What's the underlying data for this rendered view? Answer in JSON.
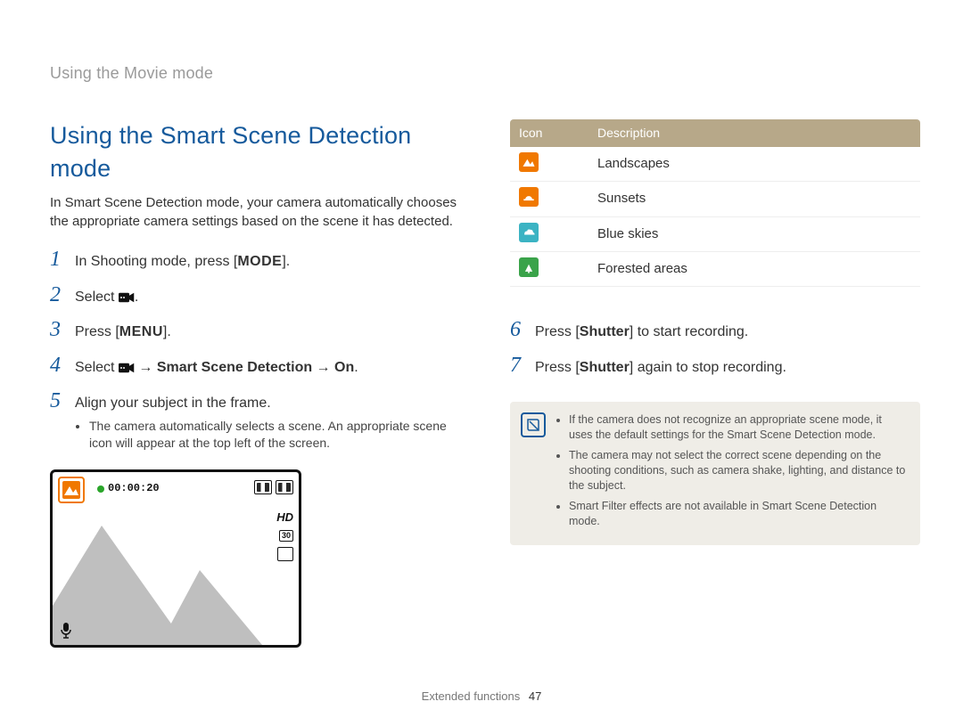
{
  "breadcrumb": "Using the Movie mode",
  "title": "Using the Smart Scene Detection mode",
  "intro": "In Smart Scene Detection mode, your camera automatically chooses the appropriate camera settings based on the scene it has detected.",
  "steps": {
    "1": {
      "pre": "In Shooting mode, press [",
      "key": "MODE",
      "post": "]."
    },
    "2": {
      "pre": "Select ",
      "post": "."
    },
    "3": {
      "pre": "Press [",
      "key": "MENU",
      "post": "]."
    },
    "4": {
      "pre": "Select ",
      "arrow": " → ",
      "bold1": "Smart Scene Detection",
      "bold2": "On",
      "post": "."
    },
    "5": {
      "text": "Align your subject in the frame.",
      "bullets": [
        "The camera automatically selects a scene. An appropriate scene icon will appear at the top left of the screen."
      ]
    },
    "6": {
      "pre": "Press [",
      "key": "Shutter",
      "post": "] to start recording."
    },
    "7": {
      "pre": "Press [",
      "key": "Shutter",
      "post": "] again to stop recording."
    }
  },
  "lcd": {
    "time": "00:00:20",
    "hd": "HD",
    "chip": "30"
  },
  "table": {
    "headers": [
      "Icon",
      "Description"
    ],
    "rows": [
      {
        "color": "orange",
        "glyph": "landscape",
        "label": "Landscapes"
      },
      {
        "color": "orange",
        "glyph": "sunset",
        "label": "Sunsets"
      },
      {
        "color": "cyan",
        "glyph": "sky",
        "label": "Blue skies"
      },
      {
        "color": "green",
        "glyph": "forest",
        "label": "Forested areas"
      }
    ]
  },
  "notes": [
    "If the camera does not recognize an appropriate scene mode, it uses the default settings for the Smart Scene Detection mode.",
    "The camera may not select the correct scene depending on the shooting conditions, such as camera shake, lighting, and distance to the subject.",
    "Smart Filter effects are not available in Smart Scene Detection mode."
  ],
  "footer": {
    "section": "Extended functions",
    "page": "47"
  }
}
